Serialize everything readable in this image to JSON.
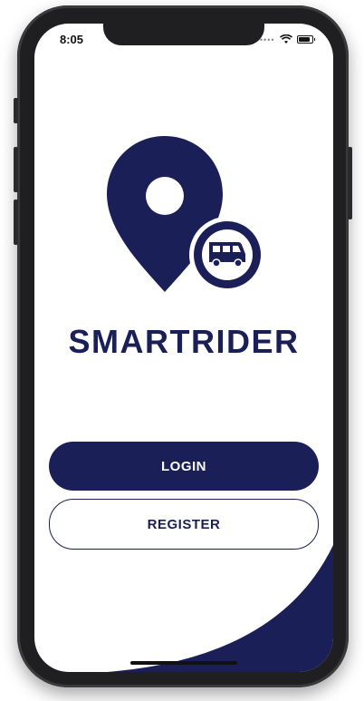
{
  "status_bar": {
    "time": "8:05"
  },
  "app": {
    "title": "SMARTRIDER"
  },
  "buttons": {
    "login_label": "LOGIN",
    "register_label": "REGISTER"
  },
  "icons": {
    "logo": "location-pin-with-van",
    "signal": "cellular-dots",
    "wifi": "wifi-icon",
    "battery": "battery-icon"
  },
  "colors": {
    "primary": "#1a1f57",
    "background": "#ffffff"
  }
}
